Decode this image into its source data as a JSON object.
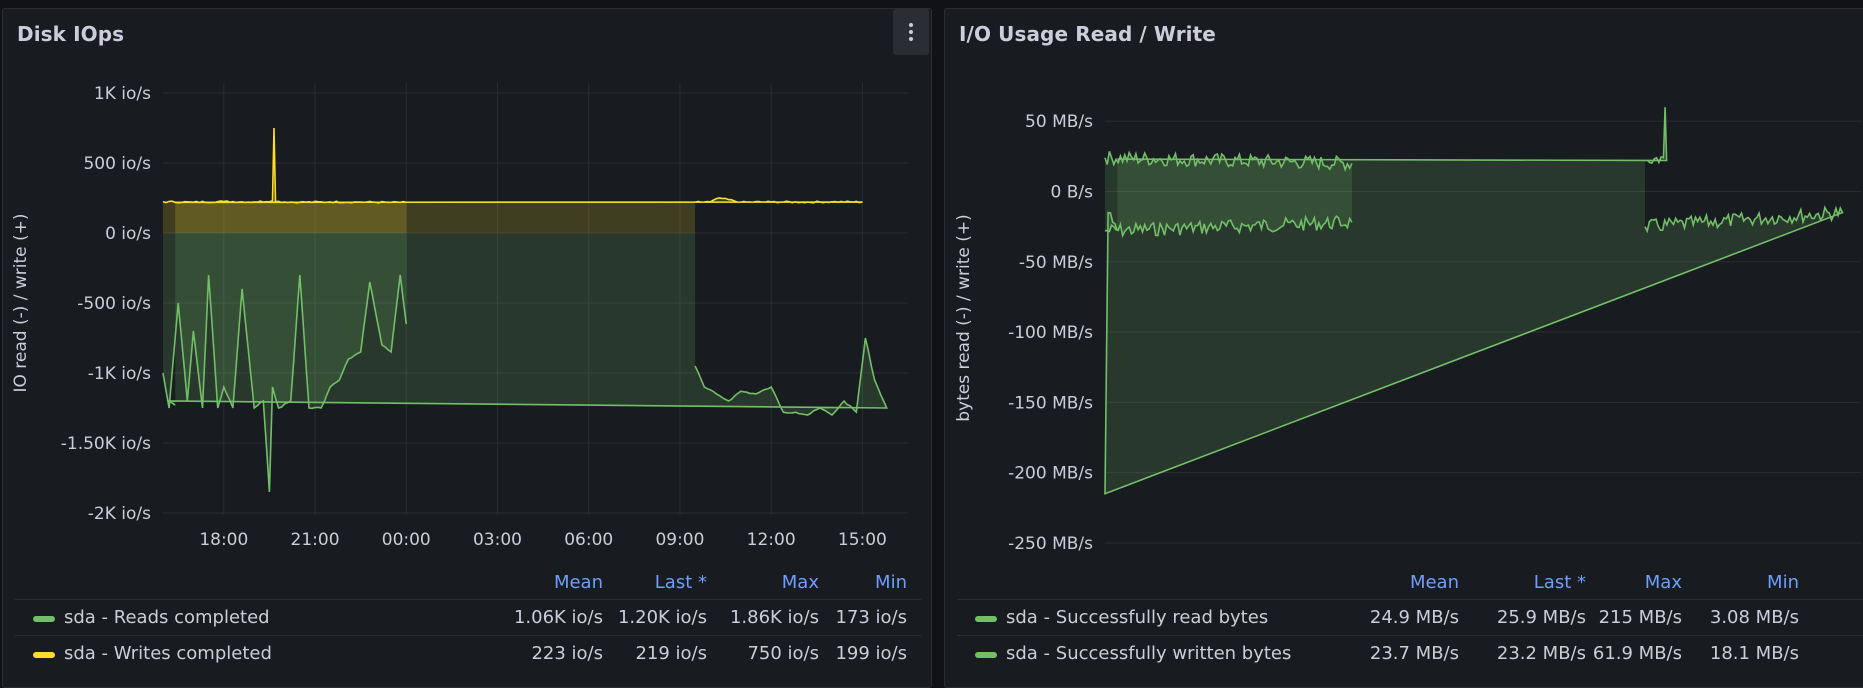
{
  "panels": [
    {
      "title": "Disk IOps",
      "menu_icon": "kebab-menu-icon",
      "chart_data": {
        "type": "area",
        "ylabel": "IO read (-) / write (+)",
        "y_ticks": [
          "1K io/s",
          "500 io/s",
          "0 io/s",
          "-500 io/s",
          "-1K io/s",
          "-1.50K io/s",
          "-2K io/s"
        ],
        "y_tick_values": [
          1000,
          500,
          0,
          -500,
          -1000,
          -1500,
          -2000
        ],
        "x_ticks": [
          "18:00",
          "21:00",
          "00:00",
          "03:00",
          "06:00",
          "09:00",
          "12:00",
          "15:00"
        ],
        "ylim": [
          -2000,
          1000
        ],
        "series": [
          {
            "name": "sda - Reads completed",
            "color": "#73bf69",
            "segments": [
              {
                "t": [
                  16.0,
                  16.2,
                  16.5,
                  16.8,
                  17.0,
                  17.3,
                  17.5,
                  17.8,
                  18.0,
                  18.3,
                  18.6,
                  19.0,
                  19.3,
                  19.5,
                  19.6,
                  19.8,
                  20.2,
                  20.5,
                  20.8,
                  21.2,
                  21.5,
                  21.8,
                  22.1,
                  22.5,
                  22.8,
                  23.2,
                  23.5,
                  23.8,
                  24.0
                ],
                "v": [
                  -1000,
                  -1250,
                  -500,
                  -1200,
                  -700,
                  -1250,
                  -300,
                  -1250,
                  -1100,
                  -1250,
                  -400,
                  -1250,
                  -1200,
                  -1850,
                  -1100,
                  -1250,
                  -1200,
                  -300,
                  -1250,
                  -1250,
                  -1100,
                  -1050,
                  -900,
                  -850,
                  -350,
                  -800,
                  -850,
                  -300,
                  -650
                ]
              },
              {
                "t": [
                  9.5,
                  9.8,
                  10.2,
                  10.6,
                  11.0,
                  11.5,
                  12.0,
                  12.4,
                  12.8,
                  13.2,
                  13.6,
                  14.0,
                  14.4,
                  14.8,
                  15.1,
                  15.4,
                  15.8,
                  16.2,
                  16.4
                ],
                "v": [
                  -950,
                  -1100,
                  -1150,
                  -1200,
                  -1130,
                  -1150,
                  -1100,
                  -1280,
                  -1280,
                  -1300,
                  -1250,
                  -1300,
                  -1200,
                  -1280,
                  -750,
                  -1050,
                  -1250,
                  -1200,
                  -1230
                ]
              }
            ]
          },
          {
            "name": "sda - Writes completed",
            "color": "#fade2a",
            "segments": [
              {
                "t": [
                  16.0,
                  17.0,
                  18.0,
                  19.0,
                  19.6,
                  19.65,
                  19.7,
                  20.5,
                  21.5,
                  22.5,
                  23.5,
                  24.0
                ],
                "v": [
                  223,
                  220,
                  225,
                  222,
                  230,
                  750,
                  225,
                  220,
                  222,
                  221,
                  219,
                  219
                ]
              },
              {
                "t": [
                  9.5,
                  10.0,
                  10.3,
                  11.0,
                  12.0,
                  13.0,
                  14.0,
                  15.0,
                  16.4
                ],
                "v": [
                  220,
                  222,
                  250,
                  220,
                  222,
                  220,
                  223,
                  221,
                  219
                ]
              }
            ]
          }
        ]
      },
      "legend": {
        "headers": [
          "Mean",
          "Last *",
          "Max",
          "Min"
        ],
        "rows": [
          {
            "name": "sda - Reads completed",
            "color": "#73bf69",
            "values": [
              "1.06K io/s",
              "1.20K io/s",
              "1.86K io/s",
              "173 io/s"
            ]
          },
          {
            "name": "sda - Writes completed",
            "color": "#fade2a",
            "values": [
              "223 io/s",
              "219 io/s",
              "750 io/s",
              "199 io/s"
            ]
          }
        ]
      }
    },
    {
      "title": "I/O Usage Read / Write",
      "chart_data": {
        "type": "area",
        "ylabel": "bytes read (-) / write (+)",
        "y_ticks": [
          "50 MB/s",
          "0 B/s",
          "-50 MB/s",
          "-100 MB/s",
          "-150 MB/s",
          "-200 MB/s",
          "-250 MB/s"
        ],
        "y_tick_values": [
          50,
          0,
          -50,
          -100,
          -150,
          -200,
          -250
        ],
        "ylim": [
          -260,
          80
        ],
        "series": [
          {
            "name": "sda - Successfully read bytes",
            "color": "#73bf69",
            "segments": [
              {
                "t": [
                  16.0,
                  24.0
                ],
                "v": [
                  -28,
                  -22
                ]
              },
              {
                "t": [
                  9.5,
                  15.9,
                  16.0,
                  16.1,
                  16.4
                ],
                "v": [
                  -25,
                  -15,
                  -215,
                  -15,
                  -28
                ]
              }
            ]
          },
          {
            "name": "sda - Successfully written bytes",
            "color": "#73bf69",
            "segments": [
              {
                "t": [
                  16.0,
                  24.0
                ],
                "v": [
                  24,
                  20
                ]
              },
              {
                "t": [
                  9.5,
                  10.1,
                  10.15,
                  10.2,
                  16.4
                ],
                "v": [
                  22,
                  24,
                  60,
                  22,
                  23
                ]
              }
            ]
          }
        ]
      },
      "legend": {
        "headers": [
          "Mean",
          "Last *",
          "Max",
          "Min"
        ],
        "rows": [
          {
            "name": "sda - Successfully read bytes",
            "color": "#73bf69",
            "values": [
              "24.9 MB/s",
              "25.9 MB/s",
              "215 MB/s",
              "3.08 MB/s"
            ]
          },
          {
            "name": "sda - Successfully written bytes",
            "color": "#73bf69",
            "values": [
              "23.7 MB/s",
              "23.2 MB/s",
              "61.9 MB/s",
              "18.1 MB/s"
            ]
          }
        ]
      }
    }
  ]
}
